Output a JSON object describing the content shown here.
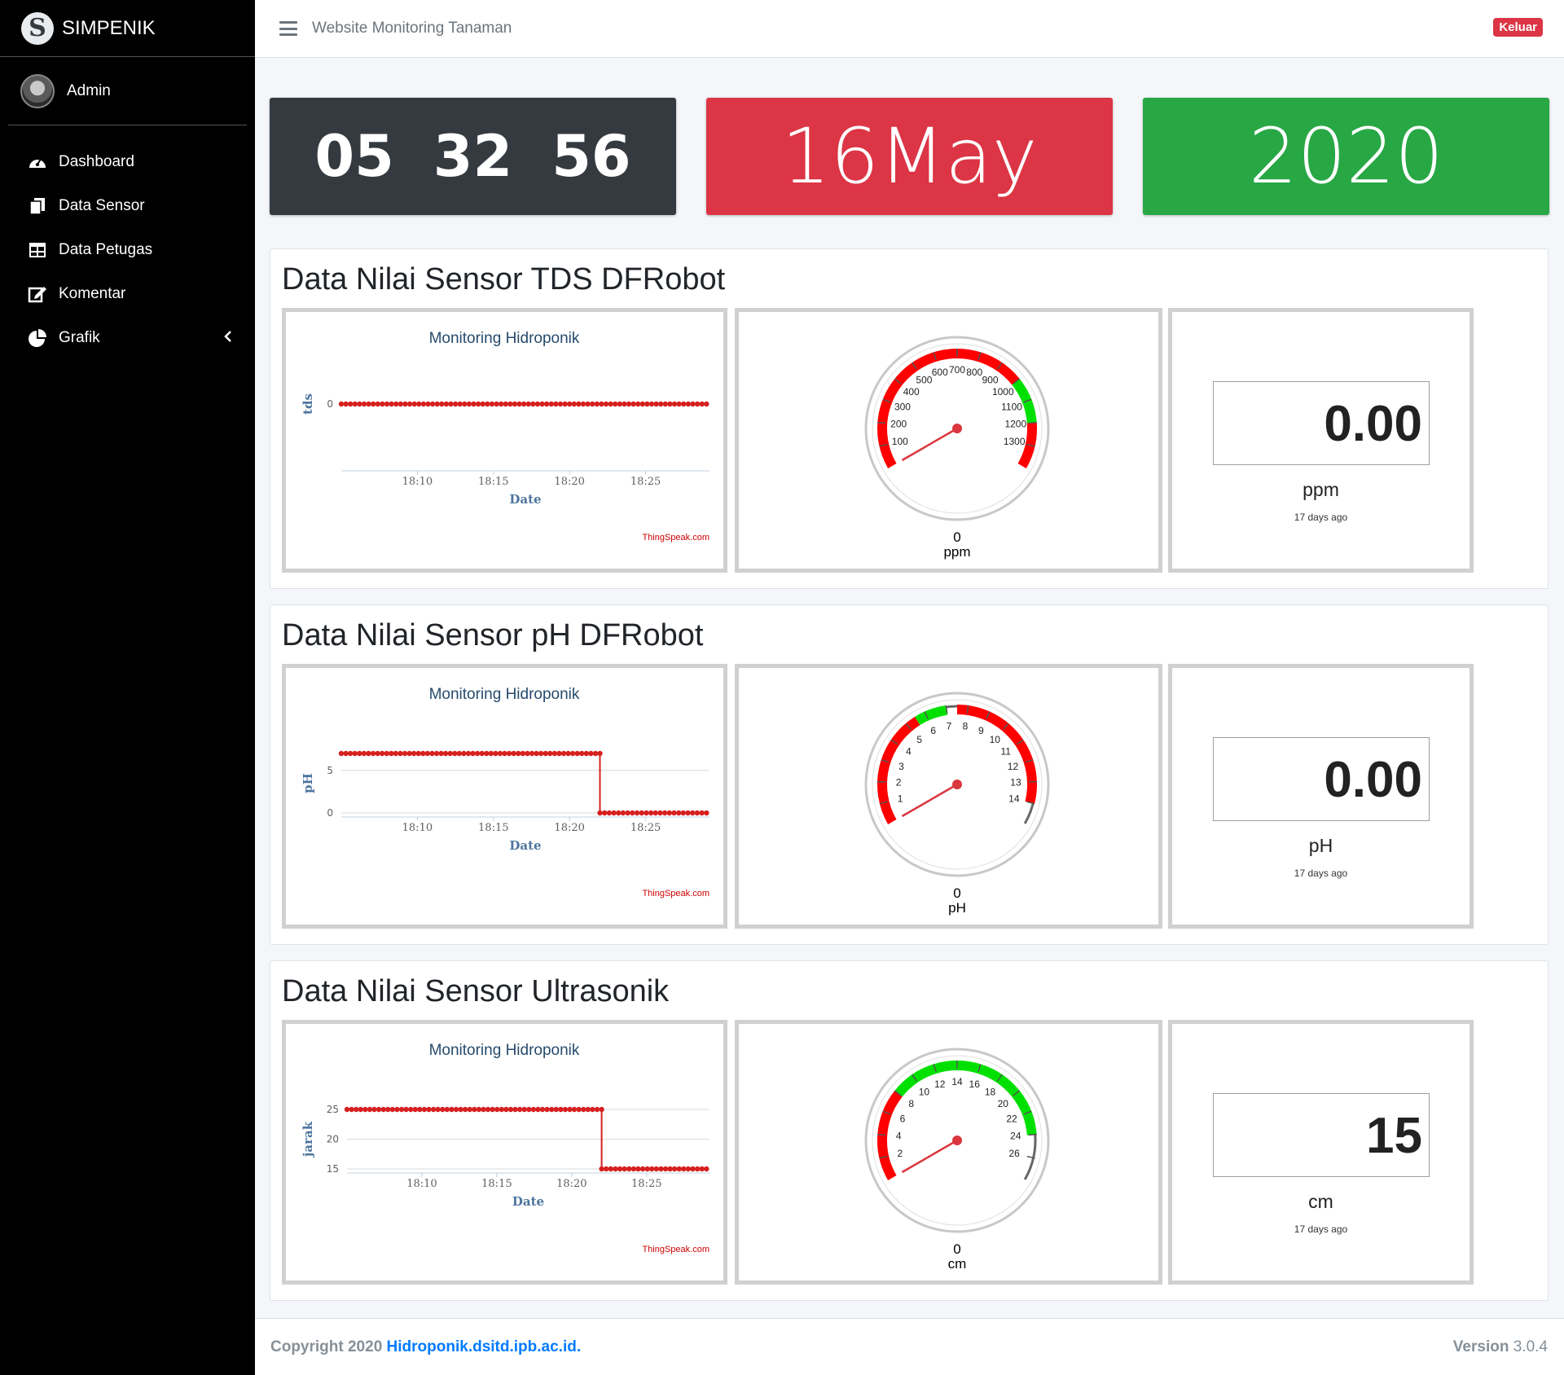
{
  "sidebar": {
    "brand_letter": "S",
    "brand": "SIMPENIK",
    "user": "Admin",
    "items": [
      {
        "label": "Dashboard",
        "icon": "tachometer-icon"
      },
      {
        "label": "Data Sensor",
        "icon": "copy-icon"
      },
      {
        "label": "Data Petugas",
        "icon": "table-icon"
      },
      {
        "label": "Komentar",
        "icon": "edit-icon"
      },
      {
        "label": "Grafik",
        "icon": "pie-chart-icon"
      }
    ]
  },
  "topbar": {
    "title": "Website Monitoring Tanaman",
    "logout": "Keluar"
  },
  "clock": {
    "h": "05",
    "m": "32",
    "s": "56"
  },
  "date": "16May",
  "year": "2020",
  "sections": [
    {
      "title": "Data Nilai Sensor TDS DFRobot",
      "chart_title": "Monitoring Hidroponik",
      "ylabel": "tds",
      "xlabel": "Date",
      "credit": "ThingSpeak.com",
      "gauge_value": "0",
      "gauge_unit": "ppm",
      "num_value": "0.00",
      "num_unit": "ppm",
      "num_ago": "17 days ago"
    },
    {
      "title": "Data Nilai Sensor pH DFRobot",
      "chart_title": "Monitoring Hidroponik",
      "ylabel": "pH",
      "xlabel": "Date",
      "credit": "ThingSpeak.com",
      "gauge_value": "0",
      "gauge_unit": "pH",
      "num_value": "0.00",
      "num_unit": "pH",
      "num_ago": "17 days ago"
    },
    {
      "title": "Data Nilai Sensor Ultrasonik",
      "chart_title": "Monitoring Hidroponik",
      "ylabel": "jarak",
      "xlabel": "Date",
      "credit": "ThingSpeak.com",
      "gauge_value": "0",
      "gauge_unit": "cm",
      "num_value": "15",
      "num_unit": "cm",
      "num_ago": "17 days ago"
    }
  ],
  "chart_data": [
    {
      "type": "line",
      "title": "Monitoring Hidroponik",
      "xlabel": "Date",
      "ylabel": "tds",
      "xticks": [
        "18:10",
        "18:15",
        "18:20",
        "18:25"
      ],
      "yticks": [
        0
      ],
      "ylim": [
        0,
        0
      ],
      "grid": true,
      "series": [
        {
          "color": "#d62020",
          "x_minutes_range": [
            18.05,
            18.3
          ],
          "segments": [
            {
              "from": "18:05",
              "to": "18:29",
              "y": 0
            }
          ]
        }
      ]
    },
    {
      "type": "line",
      "title": "Monitoring Hidroponik",
      "xlabel": "Date",
      "ylabel": "pH",
      "xticks": [
        "18:10",
        "18:15",
        "18:20",
        "18:25"
      ],
      "yticks": [
        0,
        5
      ],
      "ylim": [
        0,
        7
      ],
      "grid": true,
      "series": [
        {
          "color": "#d62020",
          "segments": [
            {
              "from": "18:05",
              "to": "18:22",
              "y": 7
            },
            {
              "from": "18:22",
              "to": "18:29",
              "y": 0
            }
          ]
        }
      ]
    },
    {
      "type": "line",
      "title": "Monitoring Hidroponik",
      "xlabel": "Date",
      "ylabel": "jarak",
      "xticks": [
        "18:10",
        "18:15",
        "18:20",
        "18:25"
      ],
      "yticks": [
        15,
        20,
        25
      ],
      "ylim": [
        15,
        25
      ],
      "grid": true,
      "series": [
        {
          "color": "#d62020",
          "segments": [
            {
              "from": "18:05",
              "to": "18:22",
              "y": 25
            },
            {
              "from": "18:22",
              "to": "18:29",
              "y": 15
            }
          ]
        }
      ]
    }
  ],
  "gauges": [
    {
      "min": 0,
      "max": 1400,
      "ticks": [
        "100",
        "200",
        "300",
        "400",
        "500",
        "600",
        "700",
        "800",
        "900",
        "1000",
        "1100",
        "1200",
        "1300"
      ],
      "value": 0,
      "bands": [
        {
          "from": 0,
          "to": 1000,
          "color": "#ff0000"
        },
        {
          "from": 1000,
          "to": 1200,
          "color": "#00e000"
        },
        {
          "from": 1200,
          "to": 1400,
          "color": "#ff0000"
        }
      ]
    },
    {
      "min": 0,
      "max": 15,
      "ticks": [
        "1",
        "2",
        "3",
        "4",
        "5",
        "6",
        "7",
        "8",
        "9",
        "10",
        "11",
        "12",
        "13",
        "14"
      ],
      "value": 0,
      "bands": [
        {
          "from": 0,
          "to": 5.5,
          "color": "#ff0000"
        },
        {
          "from": 5.5,
          "to": 7,
          "color": "#00e000"
        },
        {
          "from": 7.5,
          "to": 14,
          "color": "#ff0000"
        }
      ]
    },
    {
      "min": 0,
      "max": 28,
      "ticks": [
        "2",
        "4",
        "6",
        "8",
        "10",
        "12",
        "14",
        "16",
        "18",
        "20",
        "22",
        "24",
        "26"
      ],
      "value": 0,
      "bands": [
        {
          "from": 0,
          "to": 8,
          "color": "#ff0000"
        },
        {
          "from": 8,
          "to": 24,
          "color": "#00e000"
        }
      ]
    }
  ],
  "footer": {
    "copyright": "Copyright 2020",
    "site": "Hidroponik.dsitd.ipb.ac.id.",
    "version_label": "Version",
    "version": "3.0.4"
  }
}
